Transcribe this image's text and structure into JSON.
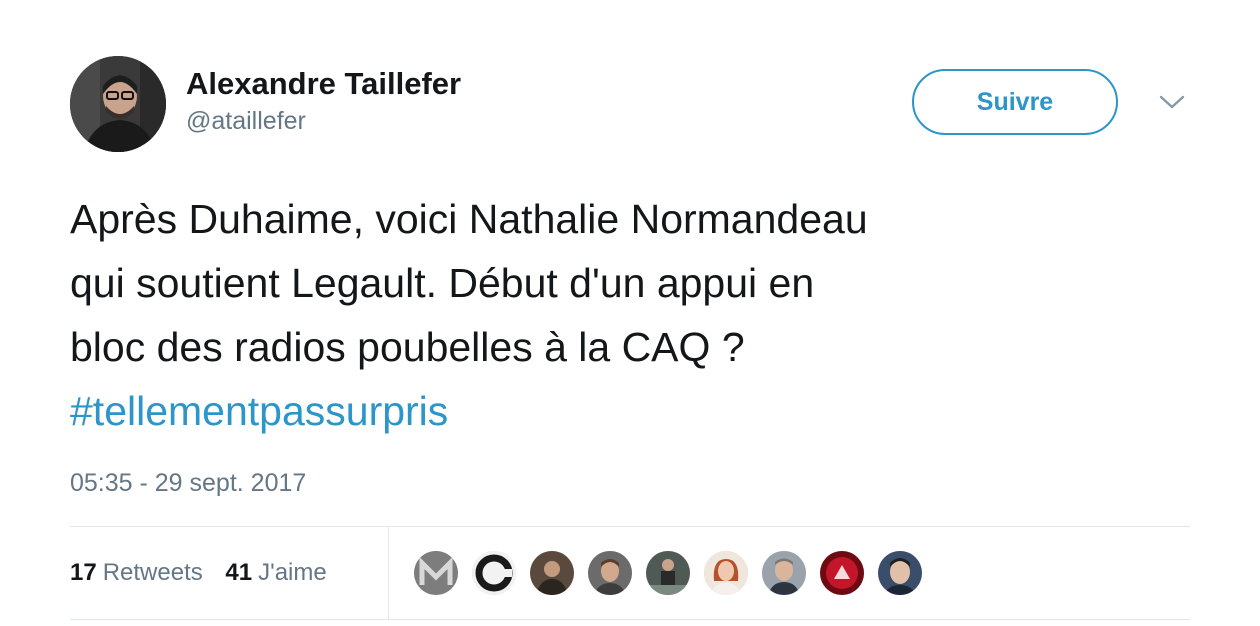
{
  "author": {
    "display_name": "Alexandre Taillefer",
    "handle": "@ataillefer",
    "avatar_icon": "person-avatar"
  },
  "follow_button": {
    "label": "Suivre"
  },
  "menu_caret_icon": "chevron-down-icon",
  "tweet": {
    "text_lines": [
      "Après Duhaime, voici Nathalie Normandeau",
      "qui soutient Legault. Début d'un appui en",
      "bloc des radios poubelles à la CAQ ?"
    ],
    "hashtag": "#tellementpassurpris",
    "timestamp": "05:35 - 29 sept. 2017"
  },
  "stats": {
    "retweets_count": "17",
    "retweets_label": "Retweets",
    "likes_count": "41",
    "likes_label": "J'aime"
  },
  "likers": [
    {
      "icon": "liker-avatar-1",
      "color": "#8a8a8a"
    },
    {
      "icon": "liker-avatar-2",
      "color": "#222222"
    },
    {
      "icon": "liker-avatar-3",
      "color": "#5a4a3e"
    },
    {
      "icon": "liker-avatar-4",
      "color": "#b08a70"
    },
    {
      "icon": "liker-avatar-5",
      "color": "#4f5a55"
    },
    {
      "icon": "liker-avatar-6",
      "color": "#d9a58a"
    },
    {
      "icon": "liker-avatar-7",
      "color": "#9aa3ab"
    },
    {
      "icon": "liker-avatar-8",
      "color": "#a3121e"
    },
    {
      "icon": "liker-avatar-9",
      "color": "#3a4d6b"
    }
  ],
  "colors": {
    "link_blue": "#2c95c9",
    "text_dark": "#14171a",
    "text_muted": "#657786",
    "divider": "#e1e8ed"
  }
}
